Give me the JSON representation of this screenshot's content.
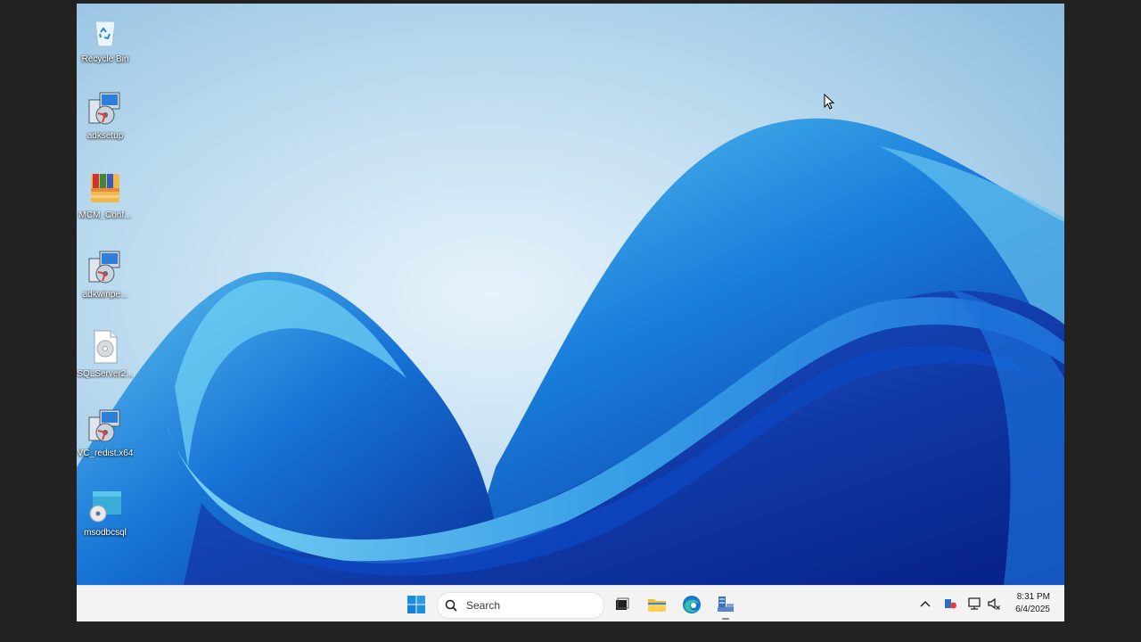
{
  "desktop": {
    "icons": [
      {
        "label": "Recycle Bin",
        "icon": "recycle-bin-icon"
      },
      {
        "label": "adksetup",
        "icon": "installer-icon"
      },
      {
        "label": "MCM_Conf...",
        "icon": "archive-icon"
      },
      {
        "label": "adkwinpe...",
        "icon": "installer-icon"
      },
      {
        "label": "SQLServer2...",
        "icon": "disc-image-file-icon"
      },
      {
        "label": "VC_redist.x64",
        "icon": "installer-icon"
      },
      {
        "label": "msodbcsql",
        "icon": "msi-package-icon"
      }
    ]
  },
  "taskbar": {
    "search_placeholder": "Search",
    "pinned": [
      "start-icon",
      "task-view-icon",
      "file-explorer-icon",
      "edge-icon",
      "server-manager-icon"
    ],
    "tray": [
      "chevron-up-icon",
      "meet-now-icon",
      "network-icon",
      "volume-icon"
    ],
    "time": "8:31 PM",
    "date": "6/4/2025"
  },
  "colors": {
    "taskbar_bg": "#f3f3f3",
    "wallpaper_sky": "#a9cde8",
    "wallpaper_deep": "#0a3cb0",
    "frame": "#222222"
  }
}
